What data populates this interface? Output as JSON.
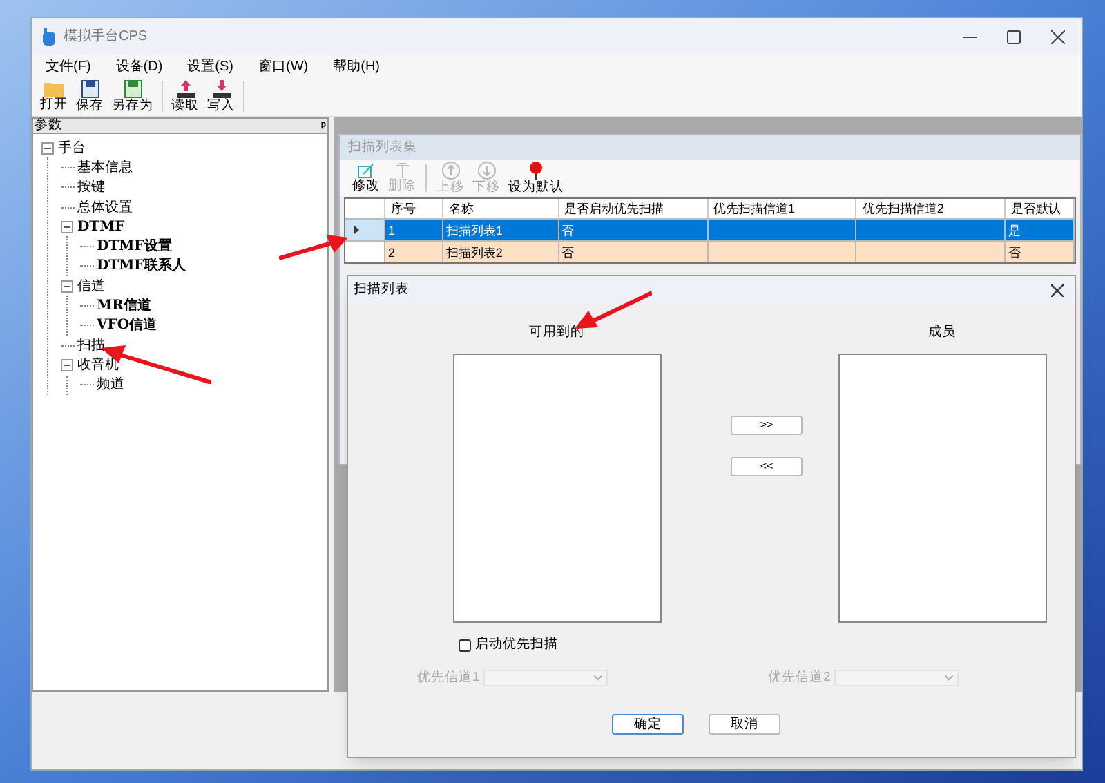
{
  "window": {
    "title": "模拟手台CPS"
  },
  "menu": [
    "文件(F)",
    "设备(D)",
    "设置(S)",
    "窗口(W)",
    "帮助(H)"
  ],
  "toolbar": [
    {
      "label": "打开",
      "kind": "folder"
    },
    {
      "label": "保存",
      "kind": "save"
    },
    {
      "label": "另存为",
      "kind": "saveas"
    },
    {
      "label": "读取",
      "kind": "read"
    },
    {
      "label": "写入",
      "kind": "write"
    }
  ],
  "panel": {
    "title": "参数",
    "pin": "ᵖ"
  },
  "tree": [
    {
      "label": "手台",
      "expanded": true,
      "children": [
        {
          "label": "基本信息"
        },
        {
          "label": "按键"
        },
        {
          "label": "总体设置"
        },
        {
          "label": "DTMF",
          "expanded": true,
          "children": [
            {
              "label": "DTMF设置"
            },
            {
              "label": "DTMF联系人"
            }
          ]
        },
        {
          "label": "信道",
          "expanded": true,
          "children": [
            {
              "label": "MR信道"
            },
            {
              "label": "VFO信道"
            }
          ]
        },
        {
          "label": "扫描"
        },
        {
          "label": "收音机",
          "expanded": true,
          "children": [
            {
              "label": "频道"
            }
          ]
        }
      ]
    }
  ],
  "child_window": {
    "title": "扫描列表集",
    "toolbar": [
      {
        "label": "修改",
        "kind": "edit",
        "disabled": false
      },
      {
        "label": "删除",
        "kind": "delete",
        "disabled": true
      },
      {
        "label": "上移",
        "kind": "up",
        "disabled": true
      },
      {
        "label": "下移",
        "kind": "down",
        "disabled": true
      },
      {
        "label": "设为默认",
        "kind": "pin",
        "disabled": false
      }
    ],
    "table": {
      "columns": [
        "序号",
        "名称",
        "是否启动优先扫描",
        "优先扫描信道1",
        "优先扫描信道2",
        "是否默认"
      ],
      "rows": [
        {
          "cells": [
            "1",
            "扫描列表1",
            "否",
            "",
            "",
            "是"
          ],
          "selected": true
        },
        {
          "cells": [
            "2",
            "扫描列表2",
            "否",
            "",
            "",
            "否"
          ],
          "selected": false
        }
      ]
    }
  },
  "dialog": {
    "title": "扫描列表",
    "available_label": "可用到的",
    "members_label": "成员",
    "add_button": ">>",
    "remove_button": "<<",
    "priority_checkbox": {
      "label": "启动优先扫描",
      "checked": false
    },
    "combos": [
      {
        "label": "优先信道1",
        "disabled": true
      },
      {
        "label": "优先信道2",
        "disabled": true
      }
    ],
    "buttons": [
      "确定",
      "取消"
    ]
  }
}
